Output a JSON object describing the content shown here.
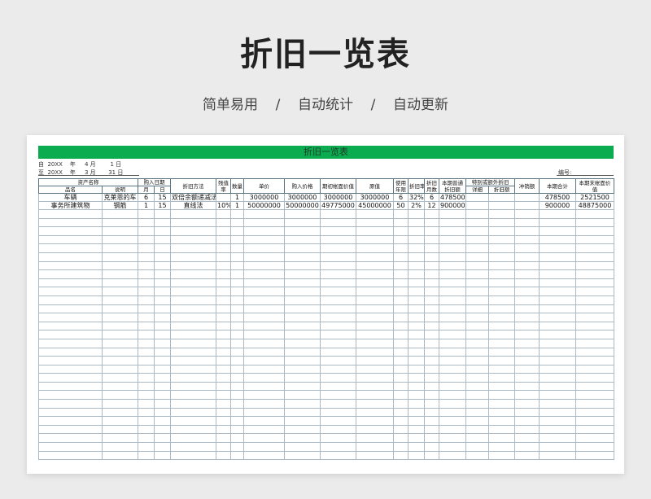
{
  "hero": {
    "title": "折旧一览表",
    "subtitle": "简单易用    /    自动统计    /    自动更新"
  },
  "sheet": {
    "header": "折旧一览表",
    "from": "自  20XX    年     4 月        1 日",
    "to": "至  20XX    年     3 月       31 日",
    "number_label": "编号:"
  },
  "columns": {
    "asset_name": "资产名称",
    "item_name": "品名",
    "description": "说明",
    "purchase_date": "购入日期",
    "month": "月",
    "day": "日",
    "method": "折旧方法",
    "residual_rate": "残值率",
    "quantity": "数量",
    "unit_price": "单价",
    "purchase_price": "购入价格",
    "opening_book_value": "期初帐面价值",
    "original_value": "原值",
    "useful_life": "使用年限",
    "depreciation_rate": "折旧率",
    "depreciation_months": "折旧月数",
    "regular_depreciation": "本期普通折旧额",
    "special_depreciation": "特别或额外折旧",
    "detail": "详细",
    "depreciation_amount": "折旧额",
    "write_off": "冲销额",
    "period_total": "本期合计",
    "closing_book_value": "本期末帐面价值"
  },
  "rows": [
    {
      "item": "车辆",
      "desc": "克莱恩的车",
      "month": "6",
      "day": "15",
      "method": "双倍余额递减法",
      "residual": "",
      "qty": "1",
      "unit_price": "3000000",
      "purchase_price": "3000000",
      "opening": "3000000",
      "original": "3000000",
      "life": "6",
      "rate": "32%",
      "months": "6",
      "regular": "478500",
      "detail": "",
      "special_amount": "",
      "write_off": "",
      "total": "478500",
      "closing": "2521500"
    },
    {
      "item": "事务所建筑物",
      "desc": "钢筋",
      "month": "1",
      "day": "15",
      "method": "直线法",
      "residual": "10%",
      "qty": "1",
      "unit_price": "50000000",
      "purchase_price": "50000000",
      "opening": "49775000",
      "original": "45000000",
      "life": "50",
      "rate": "2%",
      "months": "12",
      "regular": "900000",
      "detail": "",
      "special_amount": "",
      "write_off": "",
      "total": "900000",
      "closing": "48875000"
    }
  ],
  "colors": {
    "header_bar": "#0bab4f",
    "grid_line": "#aab9c3"
  }
}
